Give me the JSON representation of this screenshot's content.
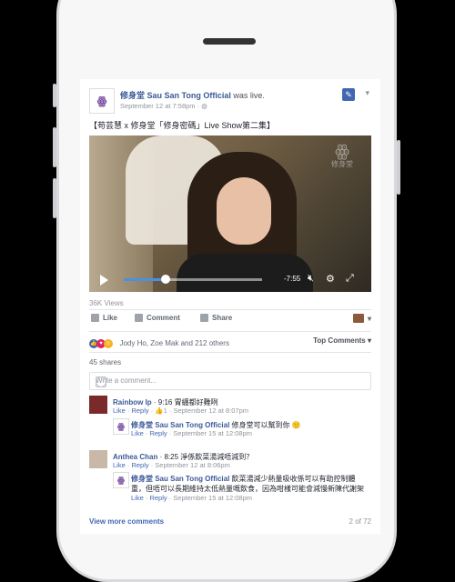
{
  "post": {
    "page_name": "修身堂 Sau San Tong Official",
    "live_text": "was live.",
    "time": "September 12 at 7:58pm · ",
    "text": "【苟芸慧 x 修身堂「修身密碼」Live Show第二集】"
  },
  "video": {
    "watermark": "修身堂",
    "time_remaining": "-7:55",
    "progress": 0.3
  },
  "stats": {
    "views": "36K Views",
    "reactions_text": "Jody Ho, Zoe Mak and 212 others",
    "top_comments": "Top Comments ▾",
    "shares": "45 shares"
  },
  "actions": {
    "like": "Like",
    "comment": "Comment",
    "share": "Share"
  },
  "comment_input": {
    "placeholder": "Write a comment..."
  },
  "comments": [
    {
      "name": "Rainbow Ip",
      "text": " · 9:16 胃纏都好難咧",
      "meta_like": "Like",
      "meta_reply": "Reply",
      "meta_rest": " · 👍1 · September 12 at 8:07pm",
      "reply": {
        "name": "修身堂 Sau San Tong Official",
        "text": " 修身堂可以幫到你 🙂",
        "meta_like": "Like",
        "meta_reply": "Reply",
        "meta_rest": " · September 15 at 12:08pm"
      }
    },
    {
      "name": "Anthea Chan",
      "text": " · 8:25 淨係飲菜湯減唔減到？",
      "meta_like": "Like",
      "meta_reply": "Reply",
      "meta_rest": " · September 12 at 8:06pm",
      "reply": {
        "name": "修身堂 Sau San Tong Official",
        "text_line1": " 飲菜湯減少熱量吸收係可以有助控制體",
        "text_line2": "重，但唔可以長期維持太低熱量嘅飲食，因為咁樣可能會減慢新陳代謝架",
        "meta_like": "Like",
        "meta_reply": "Reply",
        "meta_rest": " · September 15 at 12:08pm"
      }
    }
  ],
  "footer": {
    "view_more": "View more comments",
    "count": "2 of 72"
  },
  "colors": {
    "brand": "#3b5998",
    "link": "#4267b2",
    "logo": "#7b4ea3"
  }
}
